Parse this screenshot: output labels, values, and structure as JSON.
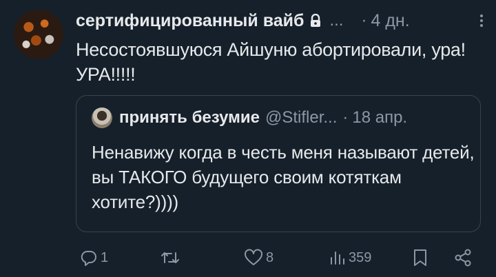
{
  "tweet": {
    "author_name": "сертифицированный вайб",
    "handle_truncated": "...",
    "time": "4 дн.",
    "text": "Несостоявшуюся Айшуню абортировали, ура! УРА!!!!!"
  },
  "quoted": {
    "author_name": "принять безумие",
    "handle": "@Stifler...",
    "time": "18 апр.",
    "text": "Ненавижу когда в честь меня называют детей, вы ТАКОГО будущего своим котяткам хотите?))))"
  },
  "actions": {
    "replies": "1",
    "reposts": "",
    "likes": "8",
    "views": "359"
  },
  "colors": {
    "background": "#15202b",
    "text": "#e7e9ea",
    "muted": "#8b98a5",
    "border": "#38444d"
  },
  "icons": [
    "lock-icon",
    "more-icon",
    "reply-icon",
    "repost-icon",
    "like-icon",
    "views-icon",
    "bookmark-icon",
    "share-icon"
  ]
}
